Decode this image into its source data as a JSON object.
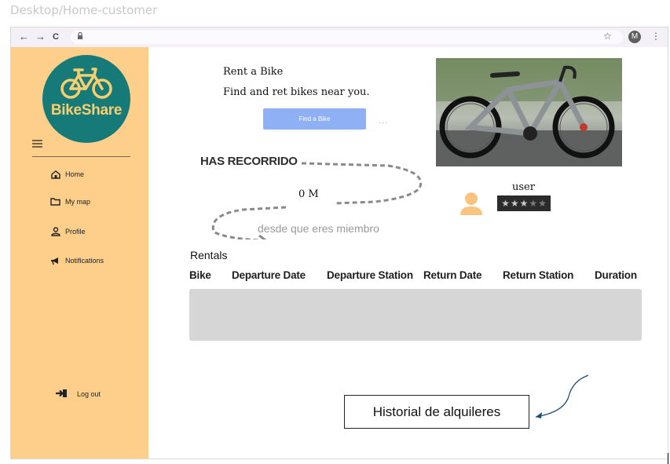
{
  "window": {
    "title": "Desktop/Home-customer"
  },
  "browser": {
    "nav": {
      "back": "←",
      "forward": "→",
      "reload": "C"
    },
    "lock_glyph": "🔒",
    "bookmark_glyph": "☆",
    "profile_initial": "M",
    "menu_glyph": "⋮"
  },
  "sidebar": {
    "logo": {
      "text": "BikeShare",
      "bg": "#167a78",
      "fg": "#f7ce70"
    },
    "items": [
      {
        "label": "Home",
        "icon": "home-icon"
      },
      {
        "label": "My map",
        "icon": "folder-icon"
      },
      {
        "label": "Profile",
        "icon": "person-icon"
      },
      {
        "label": "Notifications",
        "icon": "megaphone-icon"
      }
    ],
    "logout": {
      "label": "Log out",
      "icon": "logout-icon"
    },
    "bg": "#fecf8b"
  },
  "main": {
    "rent_title": "Rent a Bike",
    "rent_subtitle": "Find and ret bikes near you.",
    "find_button": "Find a Bike",
    "more_dots": "...",
    "distance": {
      "heading": "HAS RECORRIDO",
      "value": "0 M",
      "since": "desde que eres miembro"
    },
    "user": {
      "name": "user",
      "rating": 3,
      "max_rating": 5
    },
    "rentals": {
      "title": "Rentals",
      "columns": [
        "Bike",
        "Departure Date",
        "Departure Station",
        "Return Date",
        "Return Station",
        "Duration"
      ],
      "rows": []
    }
  },
  "annotation": {
    "callout": "Historial de alquileres"
  },
  "colors": {
    "accent_button": "#8fb0f4",
    "sidebar": "#fecf8b",
    "logo": "#167a78"
  }
}
